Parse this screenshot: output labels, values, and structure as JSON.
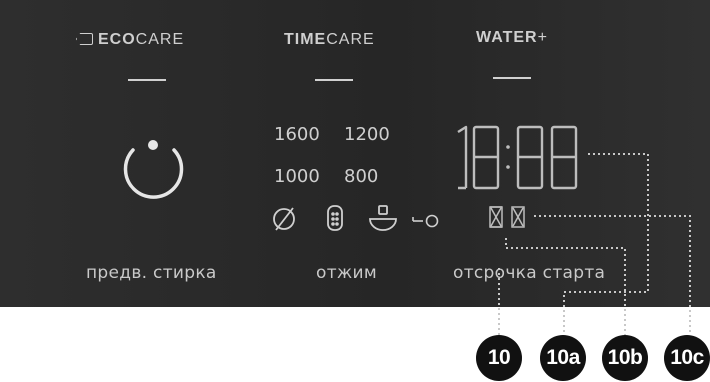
{
  "modes": {
    "eco": {
      "bold": "ECO",
      "rest": "CARE"
    },
    "time": {
      "bold": "TIME",
      "rest": "CARE"
    },
    "water": {
      "bold": "WATER",
      "rest": "+"
    }
  },
  "spin_speeds": [
    "1600",
    "1200",
    "1000",
    "800"
  ],
  "display": {
    "time": "18:88"
  },
  "labels": {
    "prewash": "предв. стирка",
    "spin": "отжим",
    "delay": "отсрочка старта"
  },
  "callouts": [
    "10",
    "10a",
    "10b",
    "10c"
  ],
  "icons": [
    "eco-leaf-icon",
    "power-icon",
    "no-spin-icon",
    "drum-icon",
    "rinse-hold-icon",
    "child-lock-icon",
    "hourglass-icon",
    "hourglass-icon"
  ]
}
